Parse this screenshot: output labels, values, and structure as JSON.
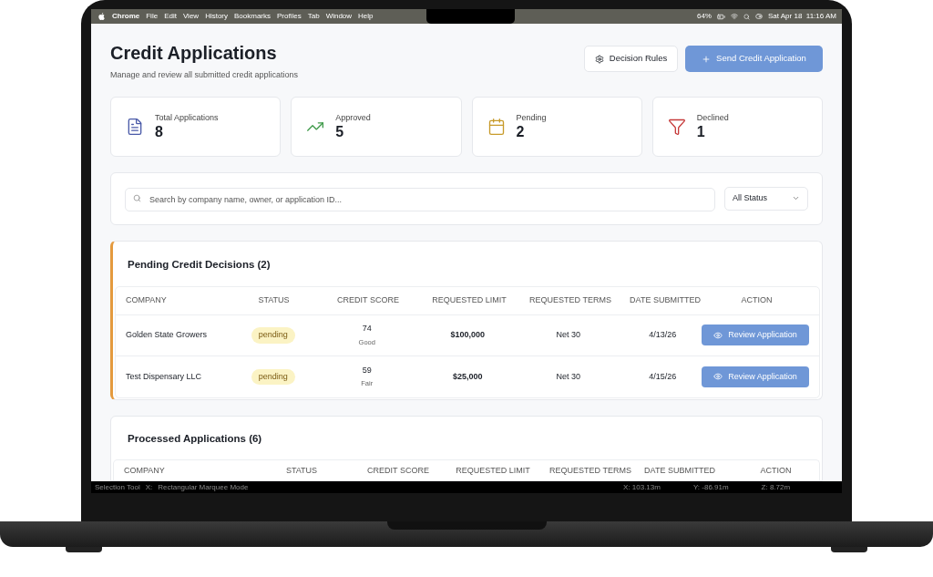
{
  "menu_bar": {
    "items": [
      {
        "label": "Chrome",
        "kind": "app"
      },
      {
        "label": "File",
        "kind": "menu"
      },
      {
        "label": "Edit",
        "kind": "menu"
      },
      {
        "label": "View",
        "kind": "menu"
      },
      {
        "label": "History",
        "kind": "menu"
      },
      {
        "label": "Bookmarks",
        "kind": "menu"
      },
      {
        "label": "Profiles",
        "kind": "menu"
      },
      {
        "label": "Tab",
        "kind": "menu"
      },
      {
        "label": "Window",
        "kind": "menu"
      },
      {
        "label": "Help",
        "kind": "menu"
      }
    ],
    "battery": "64%",
    "datetime": "Sat Apr 18  11:16 AM"
  },
  "header": {
    "title": "Credit Applications",
    "subtitle": "Manage and review all submitted credit applications",
    "buttons": [
      {
        "kind": "secondary",
        "label": "Decision Rules"
      },
      {
        "kind": "primary",
        "label": "Send Credit Application"
      }
    ]
  },
  "stats": [
    {
      "kind": "document",
      "label": "Total Applications",
      "value": "8"
    },
    {
      "kind": "trend",
      "label": "Approved",
      "value": "5"
    },
    {
      "kind": "calendar",
      "label": "Pending",
      "value": "2"
    },
    {
      "kind": "filter",
      "label": "Declined",
      "value": "1"
    }
  ],
  "search": {
    "placeholder": "Search by company name, owner, or application ID...",
    "status_filter": "All Status"
  },
  "pending": {
    "title": "Pending Credit Decisions (2)",
    "columns": [
      "COMPANY",
      "STATUS",
      "CREDIT SCORE",
      "REQUESTED LIMIT",
      "REQUESTED TERMS",
      "DATE SUBMITTED",
      "ACTION"
    ],
    "rows": [
      {
        "company": "Golden State Growers",
        "status": "pending",
        "score": "74",
        "rating": "Good",
        "limit": "$100,000",
        "terms": "Net 30",
        "date": "4/13/26",
        "action": "Review Application"
      },
      {
        "company": "Test Dispensary LLC",
        "status": "pending",
        "score": "59",
        "rating": "Fair",
        "limit": "$25,000",
        "terms": "Net 30",
        "date": "4/15/26",
        "action": "Review Application"
      }
    ]
  },
  "processed": {
    "title": "Processed Applications (6)",
    "columns": [
      "COMPANY",
      "STATUS",
      "CREDIT SCORE",
      "REQUESTED LIMIT",
      "REQUESTED TERMS",
      "DATE SUBMITTED",
      "ACTION"
    ]
  },
  "status_bar": {
    "left": [
      "Selection Tool",
      "X:",
      "Rectangular Marquee Mode"
    ],
    "right": [
      "X: 103.13m",
      "Y: -86.91m",
      "Z: 8.72m"
    ]
  }
}
